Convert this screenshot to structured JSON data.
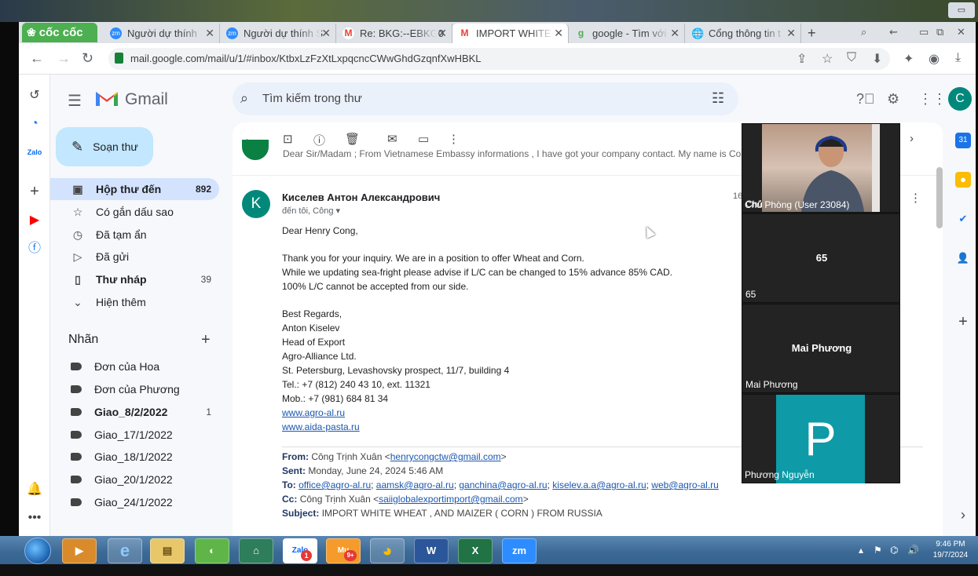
{
  "browser": {
    "brand": "cốc cốc",
    "tabs": [
      {
        "title": "Người dự thính",
        "icon": "zm",
        "color": "#2d8cff"
      },
      {
        "title": "Người dự thính S",
        "icon": "zm",
        "color": "#2d8cff"
      },
      {
        "title": "Re: BKG:--EBKG0",
        "icon": "M",
        "color": "#ea4335"
      },
      {
        "title": "IMPORT WHITE",
        "icon": "M",
        "color": "#ea4335"
      },
      {
        "title": "google - Tìm với",
        "icon": "g",
        "color": "#4caf50"
      },
      {
        "title": "Cổng thông tin t",
        "icon": "globe",
        "color": "#5f6368"
      }
    ],
    "new_tab": "+",
    "url": "mail.google.com/mail/u/1/#inbox/KtbxLzFzXtLxpqcncCWwGhdGzqnfXwHBKL"
  },
  "gmail": {
    "product_name": "Gmail",
    "search_placeholder": "Tìm kiếm trong thư",
    "compose_label": "Soạn thư",
    "account_initial": "C",
    "nav": [
      {
        "label": "Hộp thư đến",
        "count": "892",
        "icon": "inbox-icon",
        "selected": true
      },
      {
        "label": "Có gắn dấu sao",
        "count": "",
        "icon": "star-icon"
      },
      {
        "label": "Đã tạm ẩn",
        "count": "",
        "icon": "clock-icon"
      },
      {
        "label": "Đã gửi",
        "count": "",
        "icon": "send-icon"
      },
      {
        "label": "Thư nháp",
        "count": "39",
        "icon": "draft-icon",
        "bold": true
      },
      {
        "label": "Hiện thêm",
        "count": "",
        "icon": "chevron-down-icon"
      }
    ],
    "labels_heading": "Nhãn",
    "labels": [
      {
        "label": "Đơn của Hoa",
        "count": ""
      },
      {
        "label": "Đơn của Phương",
        "count": ""
      },
      {
        "label": "Giao_8/2/2022",
        "count": "1",
        "bold": true
      },
      {
        "label": "Giao_17/1/2022",
        "count": ""
      },
      {
        "label": "Giao_18/1/2022",
        "count": ""
      },
      {
        "label": "Giao_20/1/2022",
        "count": ""
      },
      {
        "label": "Giao_24/1/2022",
        "count": ""
      }
    ]
  },
  "email": {
    "prev_snippet": "Dear Sir/Madam ; From Vietnamese Embassy informations , I have got your company contact. My name is Cong",
    "sender_initial": "K",
    "sender": "Киселев Антон Александрович",
    "recipients": "đến tôi, Công",
    "date_partial": "16",
    "body": {
      "greeting": "Dear Henry Cong,",
      "p1": "Thank you for your inquiry. We are in a position to offer Wheat and Corn.",
      "p2": "While we updating sea-fright please advise if L/C can be changed to 15% advance 85% CAD.",
      "p3": "100% L/C cannot be accepted from our side.",
      "sig": [
        "Best Regards,",
        "Anton Kiselev",
        "Head of Export",
        "Agro-Alliance Ltd.",
        "St. Petersburg, Levashovsky prospect, 11/7, building 4",
        "Tel.: +7 (812) 240 43 10, ext. 11321",
        "Mob.: +7 (981) 684 81 34"
      ],
      "links": [
        "www.agro-al.ru",
        "www.aida-pasta.ru"
      ]
    },
    "quoted": {
      "from_label": "From:",
      "from_name": "Công Trịnh Xuân <",
      "from_email": "henrycongctw@gmail.com",
      "from_end": ">",
      "sent_label": "Sent:",
      "sent": "Monday, June 24, 2024 5:46 AM",
      "to_label": "To:",
      "to": [
        "office@agro-al.ru",
        "aamsk@agro-al.ru",
        "ganchina@agro-al.ru",
        "kiselev.a.a@agro-al.ru",
        "web@agro-al.ru"
      ],
      "cc_label": "Cc:",
      "cc_name": "Công Trịnh Xuân <",
      "cc_email": "saiiglobalexportimport@gmail.com",
      "cc_end": ">",
      "subject_label": "Subject:",
      "subject": "IMPORT WHITE WHEAT , AND MAIZER ( CORN ) FROM RUSSIA"
    }
  },
  "meeting": {
    "tiles": [
      {
        "name": "Chủ Phòng (User 23084)",
        "center": ""
      },
      {
        "name": "65",
        "center": "65"
      },
      {
        "name": "Mai Phương",
        "center": "Mai Phương"
      },
      {
        "name": "Phương Nguyễn",
        "center": "P"
      }
    ]
  },
  "taskbar": {
    "time": "9:46 PM",
    "date": "19/7/2024",
    "zalo_badge": "1",
    "mu_badge": "9+"
  }
}
